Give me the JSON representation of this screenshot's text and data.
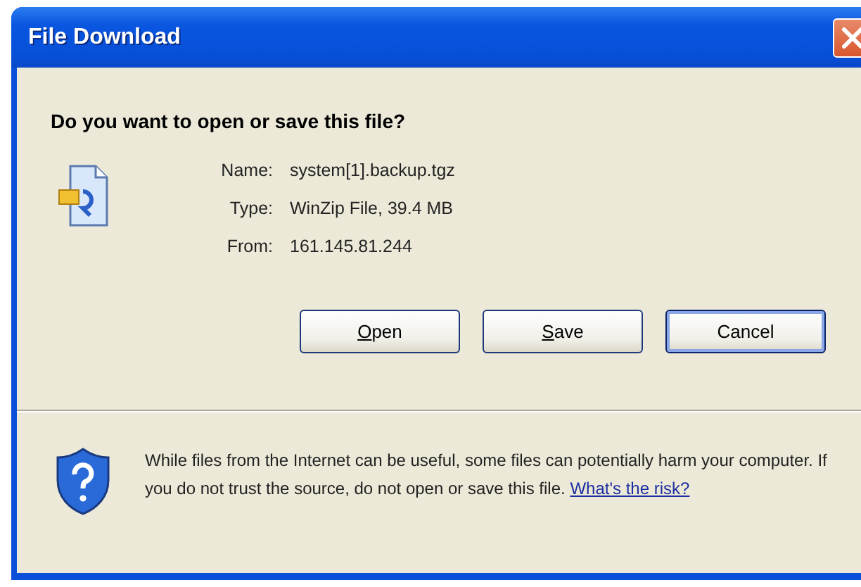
{
  "window": {
    "title": "File Download"
  },
  "question": "Do you want to open or save this file?",
  "fields": [
    {
      "label": "Name:",
      "value": "system[1].backup.tgz"
    },
    {
      "label": "Type:",
      "value": "WinZip File, 39.4 MB"
    },
    {
      "label": "From:",
      "value": "161.145.81.244"
    }
  ],
  "buttons": [
    {
      "label": "Open",
      "mnemonic": true,
      "default": false
    },
    {
      "label": "Save",
      "mnemonic": true,
      "default": false
    },
    {
      "label": "Cancel",
      "mnemonic": false,
      "default": true
    }
  ],
  "warning": {
    "text": "While files from the Internet can be useful, some files can potentially harm your computer. If you do not trust the source, do not open or save this file.",
    "link": "What's the risk?"
  }
}
